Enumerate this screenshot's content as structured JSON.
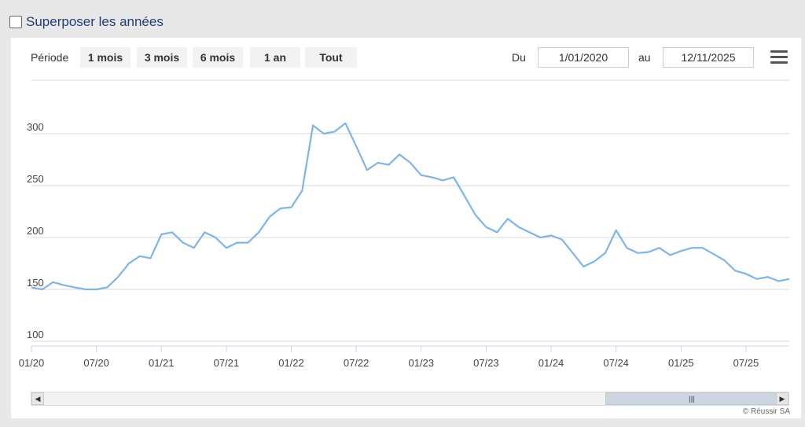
{
  "overlay": {
    "label": "Superposer les années",
    "checked": false
  },
  "toolbar": {
    "period_label": "Période",
    "range_buttons": [
      "1 mois",
      "3 mois",
      "6 mois",
      "1 an",
      "Tout"
    ],
    "from_label": "Du",
    "from_value": "1/01/2020",
    "to_label": "au",
    "to_value": "12/11/2025"
  },
  "credits": "© Réussir SA",
  "colors": {
    "line": "#7cb5ec",
    "grid": "#d8d8d8",
    "axis": "#ccd6eb"
  },
  "chart_data": {
    "type": "line",
    "title": "",
    "xlabel": "",
    "ylabel": "",
    "ylim": [
      100,
      300
    ],
    "yticks": [
      100,
      150,
      200,
      250,
      300
    ],
    "xlim": [
      "2020-01",
      "2025-11"
    ],
    "xticks": [
      "01/20",
      "07/20",
      "01/21",
      "07/21",
      "01/22",
      "07/22",
      "01/23",
      "07/23",
      "01/24",
      "07/24",
      "01/25",
      "07/25"
    ],
    "grid": true,
    "legend": "none",
    "series": [
      {
        "x": [
          "2020-01",
          "2020-02",
          "2020-03",
          "2020-04",
          "2020-05",
          "2020-06",
          "2020-07",
          "2020-08",
          "2020-09",
          "2020-10",
          "2020-11",
          "2020-12",
          "2021-01",
          "2021-02",
          "2021-03",
          "2021-04",
          "2021-05",
          "2021-06",
          "2021-07",
          "2021-08",
          "2021-09",
          "2021-10",
          "2021-11",
          "2021-12",
          "2022-01",
          "2022-02",
          "2022-03",
          "2022-04",
          "2022-05",
          "2022-06",
          "2022-07",
          "2022-08",
          "2022-09",
          "2022-10",
          "2022-11",
          "2022-12",
          "2023-01",
          "2023-02",
          "2023-03",
          "2023-04",
          "2023-05",
          "2023-06",
          "2023-07",
          "2023-08",
          "2023-09",
          "2023-10",
          "2023-11",
          "2023-12",
          "2024-01",
          "2024-02",
          "2024-03",
          "2024-04",
          "2024-05",
          "2024-06",
          "2024-07",
          "2024-08",
          "2024-09",
          "2024-10",
          "2024-11",
          "2024-12",
          "2025-01",
          "2025-02",
          "2025-03",
          "2025-04",
          "2025-05",
          "2025-06",
          "2025-07",
          "2025-08",
          "2025-09",
          "2025-10",
          "2025-11"
        ],
        "values": [
          152,
          150,
          157,
          154,
          152,
          150,
          150,
          152,
          162,
          175,
          182,
          180,
          203,
          205,
          195,
          190,
          205,
          200,
          190,
          195,
          195,
          205,
          220,
          228,
          229,
          245,
          308,
          300,
          302,
          310,
          288,
          265,
          272,
          270,
          280,
          272,
          260,
          258,
          255,
          258,
          240,
          222,
          210,
          205,
          218,
          210,
          205,
          200,
          202,
          198,
          185,
          172,
          177,
          185,
          207,
          190,
          185,
          186,
          190,
          183,
          187,
          190,
          190,
          184,
          178,
          168,
          165,
          160,
          162,
          158,
          160
        ]
      }
    ]
  }
}
